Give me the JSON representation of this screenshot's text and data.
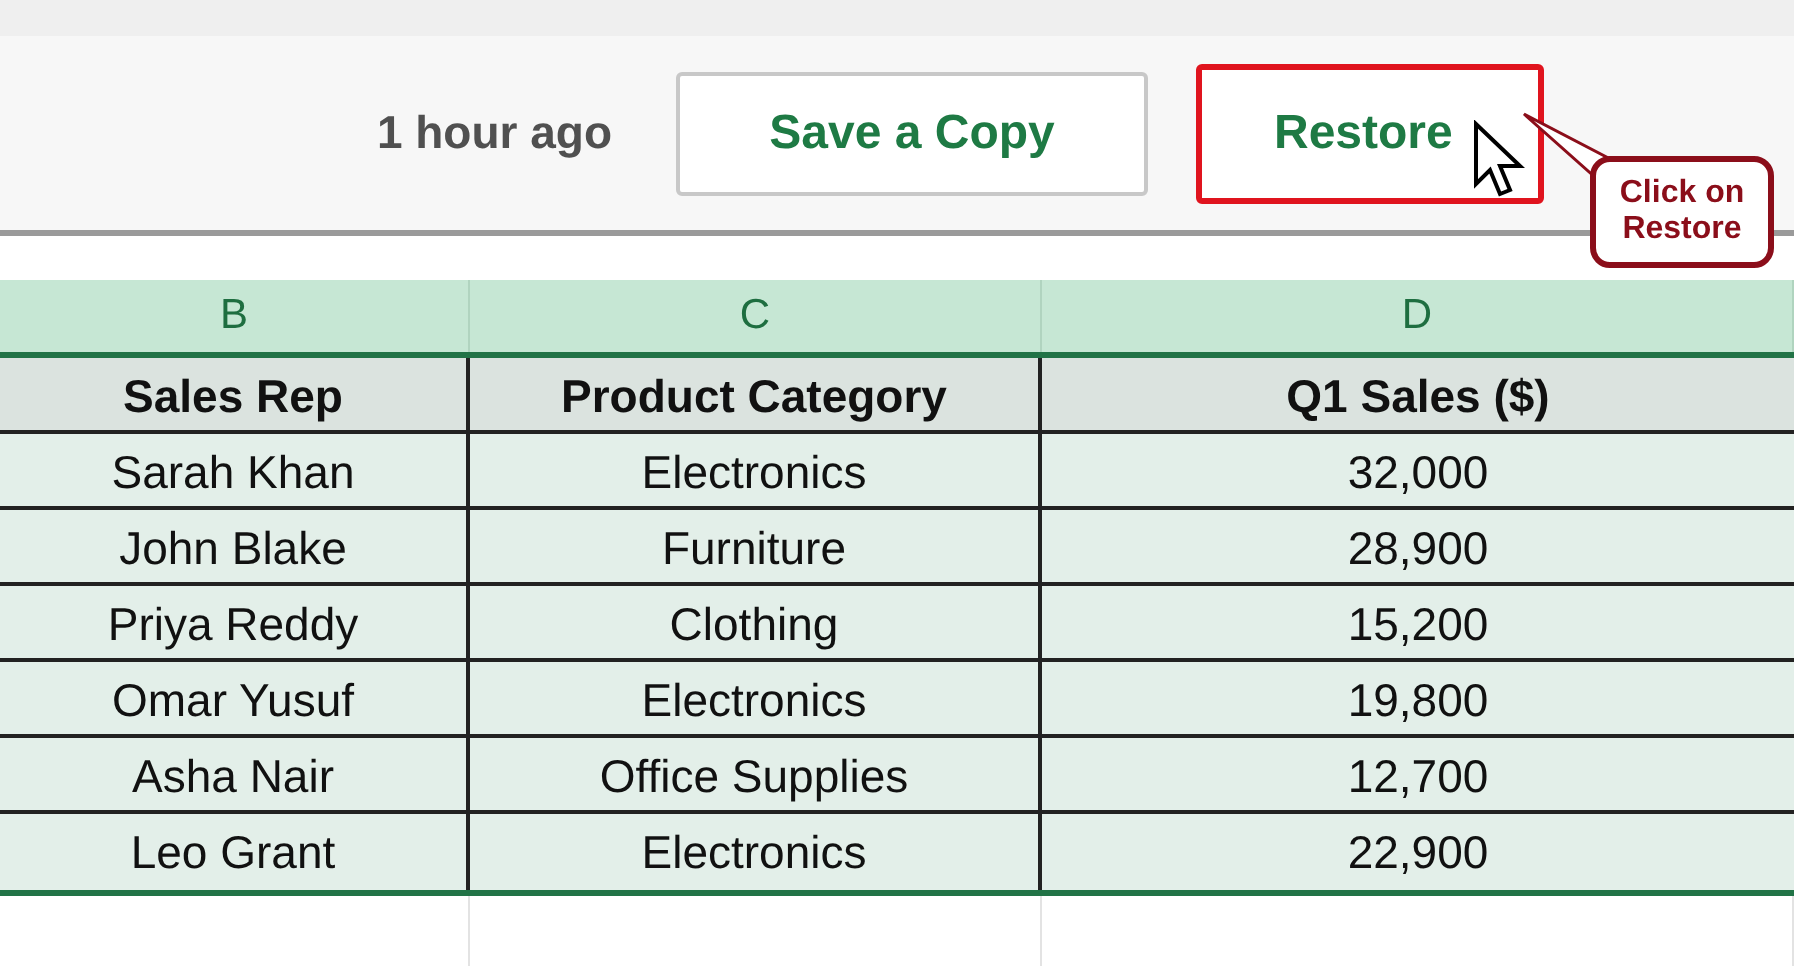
{
  "toolbar": {
    "timestamp": "1 hour ago",
    "buttons": [
      {
        "label": "Save a Copy",
        "highlighted": false
      },
      {
        "label": "Restore",
        "highlighted": true
      }
    ]
  },
  "callout": {
    "text": "Click on Restore"
  },
  "sheet": {
    "column_headers": [
      "B",
      "C",
      "D"
    ],
    "table": {
      "columns": [
        "Sales Rep",
        "Product Category",
        "Q1 Sales ($)"
      ],
      "rows": [
        [
          "Sarah Khan",
          "Electronics",
          "32,000"
        ],
        [
          "John Blake",
          "Furniture",
          "28,900"
        ],
        [
          "Priya Reddy",
          "Clothing",
          "15,200"
        ],
        [
          "Omar Yusuf",
          "Electronics",
          "19,800"
        ],
        [
          "Asha Nair",
          "Office Supplies",
          "12,700"
        ],
        [
          "Leo Grant",
          "Electronics",
          "22,900"
        ]
      ]
    }
  }
}
